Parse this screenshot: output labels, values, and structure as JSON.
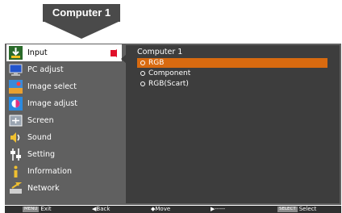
{
  "callout": {
    "label": "Computer 1"
  },
  "sidebar": {
    "items": [
      {
        "label": "Input",
        "icon": "input-icon",
        "active": true
      },
      {
        "label": "PC adjust",
        "icon": "pc-adjust-icon"
      },
      {
        "label": "Image select",
        "icon": "image-select-icon"
      },
      {
        "label": "Image adjust",
        "icon": "image-adjust-icon"
      },
      {
        "label": "Screen",
        "icon": "screen-icon"
      },
      {
        "label": "Sound",
        "icon": "sound-icon"
      },
      {
        "label": "Setting",
        "icon": "setting-icon"
      },
      {
        "label": "Information",
        "icon": "information-icon"
      },
      {
        "label": "Network",
        "icon": "network-icon"
      }
    ]
  },
  "submenu": {
    "title": "Computer 1",
    "options": [
      {
        "label": "RGB",
        "selected": true
      },
      {
        "label": "Component"
      },
      {
        "label": "RGB(Scart)"
      }
    ]
  },
  "guide": {
    "exit_key": "MENU",
    "exit_label": "Exit",
    "back_label": "Back",
    "move_label": "Move",
    "next_label": "-----",
    "select_key": "SELECT",
    "select_label": "Select"
  },
  "colors": {
    "panel": "#606060",
    "content": "#3d3d3d",
    "highlight": "#d86a10",
    "marker": "#e0102a"
  }
}
